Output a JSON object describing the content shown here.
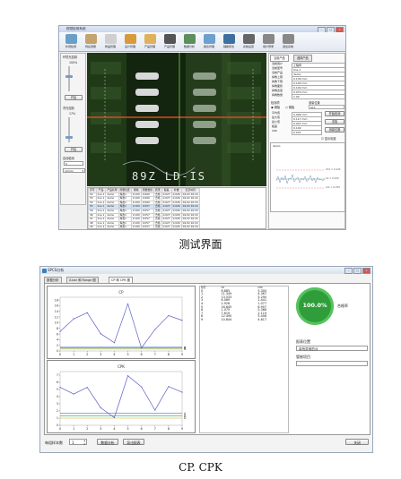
{
  "top_window": {
    "title": "视觉检测系统",
    "toolbar": [
      {
        "label": "外观检测",
        "icon": "camera-icon",
        "color": "#6aa0c8"
      },
      {
        "label": "特征测量",
        "icon": "measure-icon",
        "color": "#c4a36c"
      },
      {
        "label": "样品管理",
        "icon": "sample-icon",
        "color": "#cfcfcf"
      },
      {
        "label": "设计管理",
        "icon": "factory-icon",
        "color": "#d89a3a"
      },
      {
        "label": "产品管理",
        "icon": "product-icon",
        "color": "#e0b15a"
      },
      {
        "label": "产品管理",
        "icon": "barcode-icon",
        "color": "#555555"
      },
      {
        "label": "数据分析",
        "icon": "chart-icon",
        "color": "#5c8f5c"
      },
      {
        "label": "报表管理",
        "icon": "report-icon",
        "color": "#6ca0d0"
      },
      {
        "label": "辅助算法",
        "icon": "algorithm-icon",
        "color": "#3e6fa0"
      },
      {
        "label": "系统设置",
        "icon": "lock-icon",
        "color": "#666666"
      },
      {
        "label": "用户登录",
        "icon": "user-icon",
        "color": "#888888"
      },
      {
        "label": "退出系统",
        "icon": "exit-icon",
        "color": "#888888"
      }
    ],
    "left_panel": {
      "group1_title": "环境光控制",
      "group1_value": "100%",
      "group1_button": "开启",
      "group2_title": "背光控制",
      "group2_value": "17%",
      "group2_button": "开启",
      "group3_title": "自动检测",
      "group3_value": "0",
      "dropdown": "12mm"
    },
    "right_panel": {
      "tabs": [
        "当前产品",
        "选择产品"
      ],
      "fields": [
        {
          "k": "当前用户",
          "v": "工程师"
        },
        {
          "k": "当前型号",
          "v": "line 1"
        },
        {
          "k": "当前产品",
          "v": "demo"
        },
        {
          "k": "焊角上限",
          "v": "0.130 mm"
        },
        {
          "k": "焊角下限",
          "v": "0.100 mm"
        },
        {
          "k": "焊角面积",
          "v": "0.100 mm"
        },
        {
          "k": "焊角宽度",
          "v": "0.070 mm"
        },
        {
          "k": "焊角数量",
          "v": "1.00"
        }
      ],
      "detect_label": "检测项",
      "detect_area": "测量位置",
      "detect_options": [
        "钢板",
        "钢板"
      ],
      "detect_all": "ALL",
      "stats": [
        {
          "k": "平均值",
          "v": "0.099 mm"
        },
        {
          "k": "最大值",
          "v": "0.117 mm"
        },
        {
          "k": "最小值",
          "v": "0.047 mm"
        },
        {
          "k": "极差",
          "v": "0.100"
        },
        {
          "k": "CPK",
          "v": "0.037"
        }
      ],
      "buttons": [
        "开始检测",
        "清除",
        "测量位置"
      ],
      "checkbox": "显示标准",
      "mini_chart_title": "demo",
      "mini_chart_labels": [
        "UCL = 0.120",
        "CL = 0.100",
        "LCL = 0.070"
      ]
    },
    "image_text": "89Z LD-IS",
    "table": {
      "headers": [
        "序号",
        "产品",
        "产品名称",
        "测量位置",
        "规格",
        "测量数值",
        "结果",
        "偏差",
        "补偿",
        "记录时间"
      ],
      "rows": [
        [
          "52",
          "line 1",
          "demo",
          "焊盘1",
          "0.100",
          "0.060",
          "合格",
          "0.027",
          "0.026",
          "04-02 16:24"
        ],
        [
          "53",
          "line 1",
          "demo",
          "焊盘1",
          "0.100",
          "0.060",
          "合格",
          "0.027",
          "0.026",
          "04-02 16:24"
        ],
        [
          "54",
          "line 1",
          "demo",
          "焊盘1",
          "0.100",
          "0.060",
          "合格",
          "0.027",
          "0.026",
          "04-02 16:24"
        ],
        [
          "55",
          "line 1",
          "demo",
          "焊盘1",
          "0.100",
          "0.057",
          "合格",
          "0.027",
          "0.026",
          "04-02 16:24"
        ],
        [
          "56",
          "line 1",
          "demo",
          "焊盘1",
          "0.100",
          "0.057",
          "合格",
          "0.027",
          "0.026",
          "04-02 16:24"
        ],
        [
          "46",
          "line 1",
          "demo",
          "焊盘1",
          "0.100",
          "0.057",
          "合格",
          "0.027",
          "0.026",
          "04-02 16:24"
        ],
        [
          "47",
          "line 1",
          "demo",
          "焊盘1",
          "0.100",
          "0.057",
          "合格",
          "0.027",
          "0.026",
          "04-02 16:24"
        ],
        [
          "48",
          "line 1",
          "demo",
          "焊盘1",
          "0.100",
          "0.057",
          "合格",
          "0.027",
          "0.026",
          "04-02 16:24"
        ],
        [
          "49",
          "line 1",
          "demo",
          "焊盘1",
          "0.100",
          "0.057",
          "合格",
          "0.027",
          "0.026",
          "04-02 16:24"
        ]
      ]
    }
  },
  "caption1": "测试界面",
  "bottom_window": {
    "title": "SPCS分析",
    "tabs": [
      "数据分析",
      "X-bar 和 Range 图",
      "CP 和 CPK 图"
    ],
    "cp_chart_title": "CP",
    "cpk_chart_title": "CPK",
    "table_headers": [
      "组号",
      "CP",
      "CPK"
    ],
    "table_rows": [
      [
        "0",
        "6.885",
        "5.300"
      ],
      [
        "1",
        "11.349",
        "4.367"
      ],
      [
        "2",
        "13.533",
        "5.290"
      ],
      [
        "3",
        "6.069",
        "2.441"
      ],
      [
        "4",
        "2.926",
        "1.077"
      ],
      [
        "5",
        "16.645",
        "6.907"
      ],
      [
        "6",
        "1.075",
        "5.366"
      ],
      [
        "7",
        "7.619",
        "2.119"
      ],
      [
        "8",
        "12.490",
        "5.408"
      ],
      [
        "9",
        "10.844",
        "4.617"
      ]
    ],
    "pass_rate": "100.0%",
    "pass_label": "合格率",
    "report_label": "报表位置",
    "report_value": "将有异常的点",
    "note_label": "管制项目",
    "bottom_label": "每组样本数",
    "bottom_value": "1",
    "buttons": [
      "数据分析",
      "导出报表"
    ],
    "close_button": "关闭"
  },
  "caption2": "CP. CPK",
  "chart_data": [
    {
      "type": "line",
      "title": "CP",
      "x": [
        0,
        1,
        2,
        3,
        4,
        5,
        6,
        7,
        8,
        9
      ],
      "series": [
        {
          "values": [
            6.885,
            11.349,
            13.533,
            6.069,
            2.926,
            16.645,
            1.075,
            7.619,
            12.49,
            10.844
          ]
        }
      ],
      "reference_lines": {
        "A": 1.33,
        "B": 1.0,
        "D": 0.67
      },
      "ylim": [
        0,
        19.0
      ],
      "yticks": [
        0,
        2.0,
        4.0,
        6.0,
        8.0,
        10.0,
        12.0,
        14.0,
        16.0,
        18.0
      ],
      "xticks": [
        0,
        1,
        2,
        3,
        4,
        5,
        6,
        7,
        8,
        9
      ]
    },
    {
      "type": "line",
      "title": "CPK",
      "x": [
        0,
        1,
        2,
        3,
        4,
        5,
        6,
        7,
        8,
        9
      ],
      "series": [
        {
          "values": [
            5.3,
            4.367,
            5.29,
            2.441,
            1.077,
            6.907,
            5.366,
            2.119,
            5.408,
            4.617
          ]
        }
      ],
      "reference_lines": {
        "A": 1.67,
        "B": 1.33,
        "D": 1.0
      },
      "ylim": [
        0,
        7.5
      ],
      "yticks": [
        0,
        1.0,
        2.0,
        3.0,
        4.0,
        5.0,
        6.0,
        7.0
      ],
      "xticks": [
        0,
        1,
        2,
        3,
        4,
        5,
        6,
        7,
        8,
        9
      ]
    }
  ]
}
